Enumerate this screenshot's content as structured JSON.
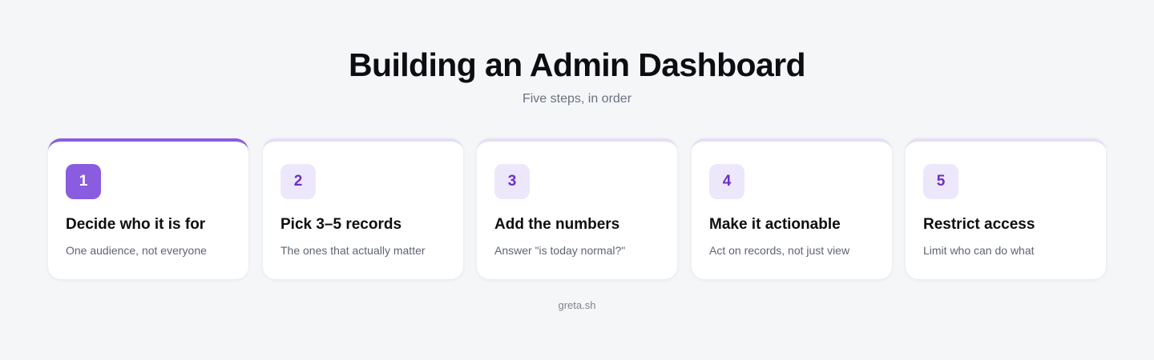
{
  "header": {
    "title": "Building an Admin Dashboard",
    "subtitle": "Five steps, in order"
  },
  "steps": [
    {
      "number": "1",
      "title": "Decide who it is for",
      "description": "One audience, not everyone",
      "active": true
    },
    {
      "number": "2",
      "title": "Pick 3–5 records",
      "description": "The ones that actually matter",
      "active": false
    },
    {
      "number": "3",
      "title": "Add the numbers",
      "description": "Answer \"is today normal?\"",
      "active": false
    },
    {
      "number": "4",
      "title": "Make it actionable",
      "description": "Act on records, not just view",
      "active": false
    },
    {
      "number": "5",
      "title": "Restrict access",
      "description": "Limit who can do what",
      "active": false
    }
  ],
  "footer": {
    "text": "greta.sh"
  },
  "colors": {
    "background": "#f5f6f8",
    "accent": "#8a5ce0",
    "accent_soft": "#ede7fb",
    "accent_text": "#6b30c8",
    "card_top_border_inactive": "#e5def8",
    "title_text": "#0d0d12",
    "muted_text": "#6b7080"
  }
}
